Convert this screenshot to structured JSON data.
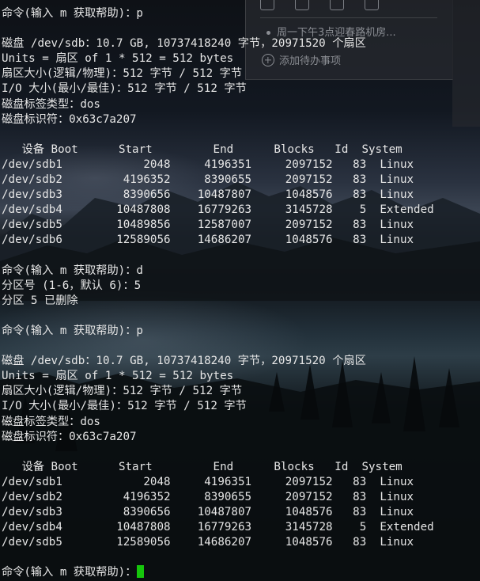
{
  "terminal": {
    "lines": [
      "命令(输入 m 获取帮助)：p",
      "",
      "磁盘 /dev/sdb：10.7 GB, 10737418240 字节，20971520 个扇区",
      "Units = 扇区 of 1 * 512 = 512 bytes",
      "扇区大小(逻辑/物理)：512 字节 / 512 字节",
      "I/O 大小(最小/最佳)：512 字节 / 512 字节",
      "磁盘标签类型：dos",
      "磁盘标识符：0x63c7a207",
      "",
      "   设备 Boot      Start         End      Blocks   Id  System",
      "/dev/sdb1            2048     4196351     2097152   83  Linux",
      "/dev/sdb2         4196352     8390655     2097152   83  Linux",
      "/dev/sdb3         8390656    10487807     1048576   83  Linux",
      "/dev/sdb4        10487808    16779263     3145728    5  Extended",
      "/dev/sdb5        10489856    12587007     2097152   83  Linux",
      "/dev/sdb6        12589056    14686207     1048576   83  Linux",
      "",
      "命令(输入 m 获取帮助)：d",
      "分区号 (1-6，默认 6)：5",
      "分区 5 已删除",
      "",
      "命令(输入 m 获取帮助)：p",
      "",
      "磁盘 /dev/sdb：10.7 GB, 10737418240 字节，20971520 个扇区",
      "Units = 扇区 of 1 * 512 = 512 bytes",
      "扇区大小(逻辑/物理)：512 字节 / 512 字节",
      "I/O 大小(最小/最佳)：512 字节 / 512 字节",
      "磁盘标签类型：dos",
      "磁盘标识符：0x63c7a207",
      "",
      "   设备 Boot      Start         End      Blocks   Id  System",
      "/dev/sdb1            2048     4196351     2097152   83  Linux",
      "/dev/sdb2         4196352     8390655     2097152   83  Linux",
      "/dev/sdb3         8390656    10487807     1048576   83  Linux",
      "/dev/sdb4        10487808    16779263     3145728    5  Extended",
      "/dev/sdb5        12589056    14686207     1048576   83  Linux",
      "",
      "命令(输入 m 获取帮助)："
    ],
    "cursor_color": "#16c60c"
  },
  "background_window": {
    "todo_item": "周一下午3点迎春路机房...",
    "add_todo_label": "添加待办事项"
  }
}
